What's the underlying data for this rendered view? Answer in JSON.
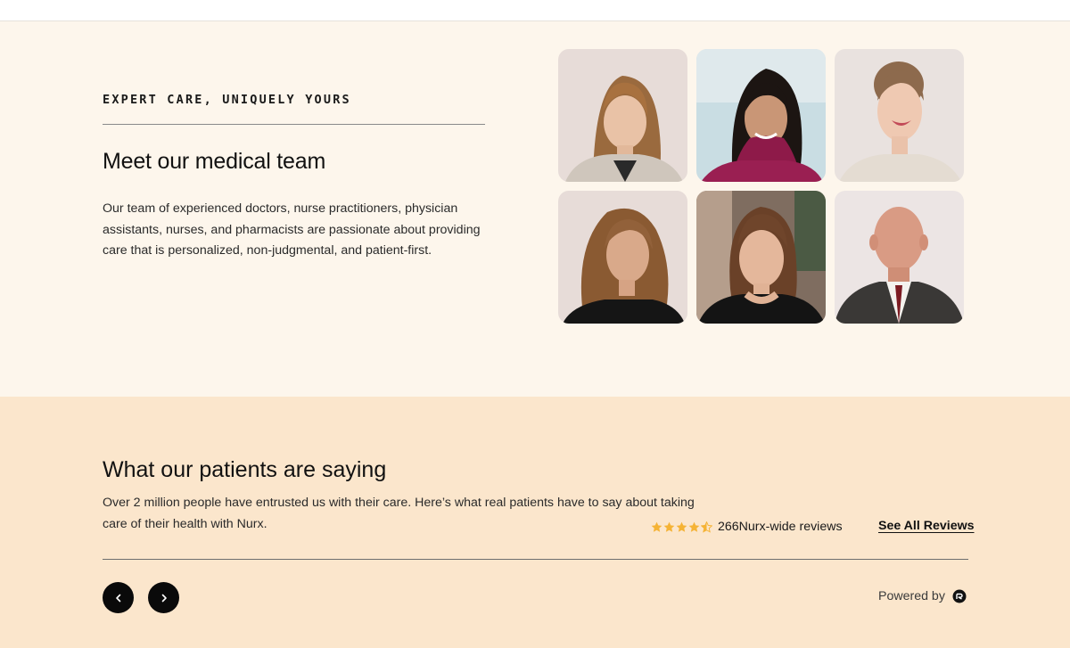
{
  "team": {
    "eyebrow": "EXPERT CARE, UNIQUELY YOURS",
    "title": "Meet our medical team",
    "description": "Our team of experienced doctors, nurse practitioners, physician assistants, nurses, and pharmacists are passionate about providing care that is personalized, non-judgmental, and patient-first."
  },
  "reviews": {
    "title": "What our patients are saying",
    "description": "Over 2 million people have entrusted us with their care. Here’s what real patients have to say about taking care of their health with Nurx.",
    "rating_stars": 4.5,
    "count_text": "266Nurx-wide reviews",
    "see_all_label": "See All Reviews",
    "powered_by_label": "Powered by"
  },
  "colors": {
    "team_bg": "#fdf6ec",
    "reviews_bg": "#fbe6cc",
    "star": "#f5b335",
    "button_bg": "#0a0a0a"
  }
}
